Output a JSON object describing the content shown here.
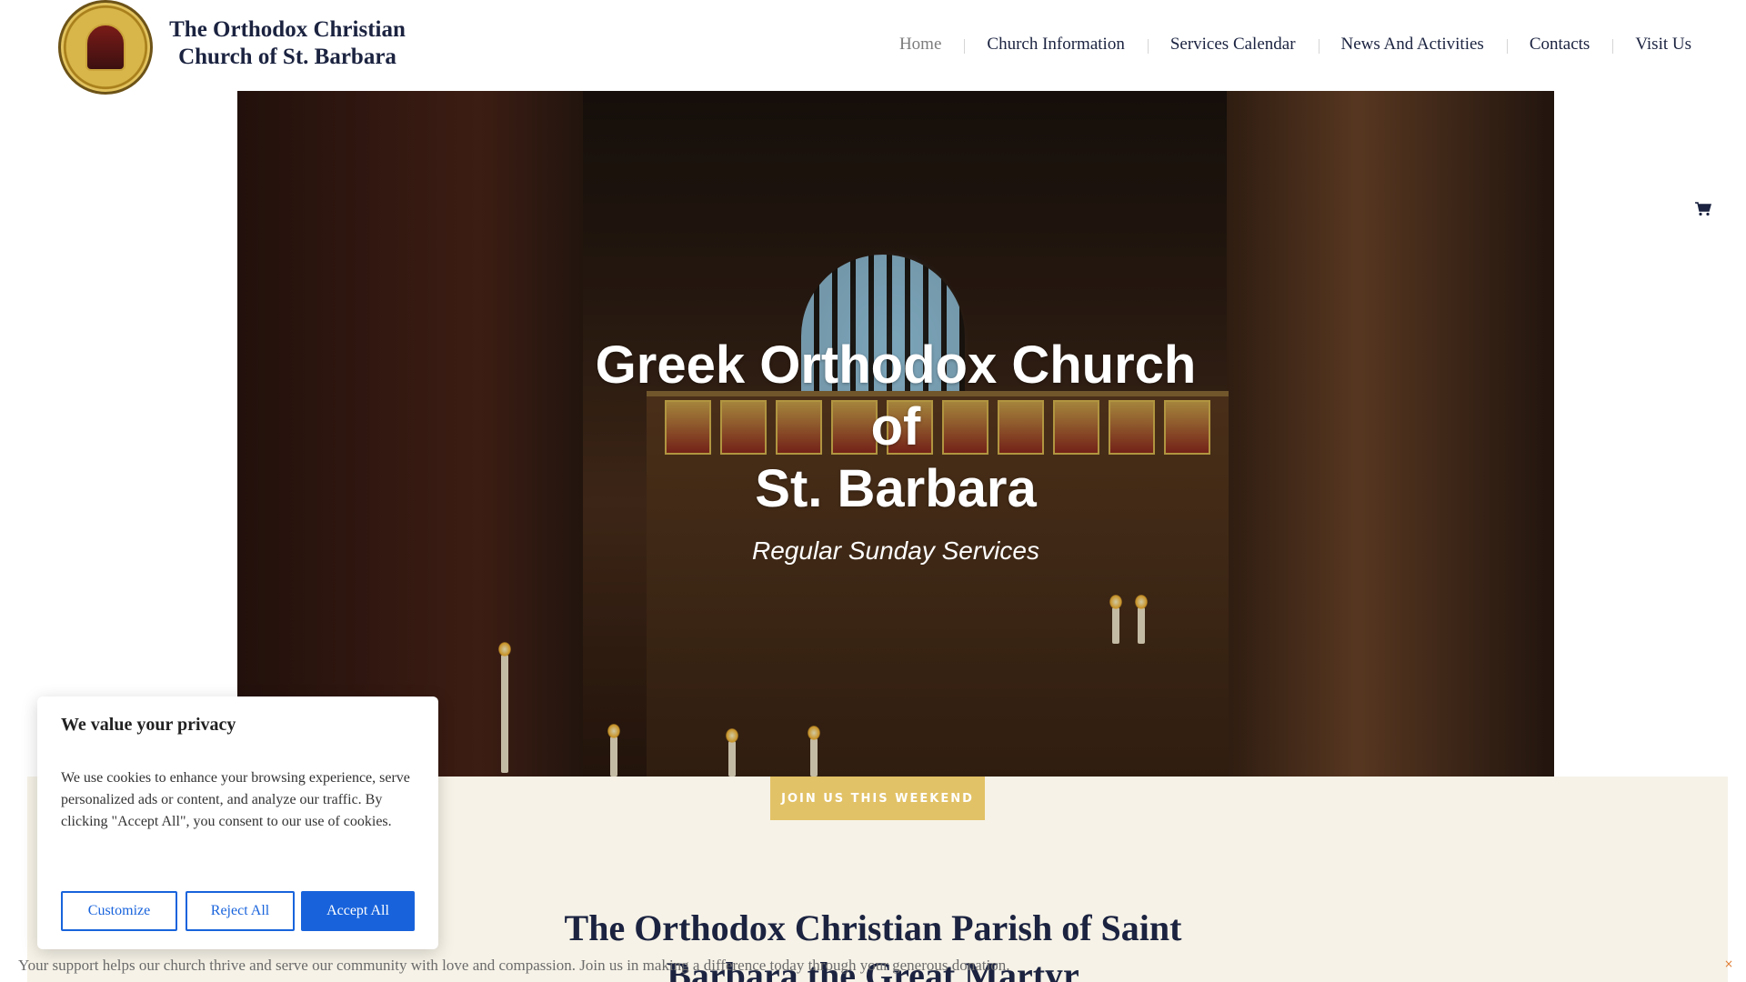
{
  "header": {
    "site_title": "The Orthodox Christian Church of St. Barbara",
    "logo_icon": "church-seal-icon",
    "nav": [
      {
        "label": "Home",
        "active": true
      },
      {
        "label": "Church Information"
      },
      {
        "label": "Services Calendar"
      },
      {
        "label": "News And Activities"
      },
      {
        "label": "Contacts"
      },
      {
        "label": "Visit Us"
      }
    ]
  },
  "hero": {
    "title_line1": "Greek Orthodox Church",
    "title_line2": "of",
    "title_line3": "St. Barbara",
    "subtitle": "Regular Sunday Services"
  },
  "cta": {
    "label": "JOIN US THIS WEEKEND",
    "color": "#e2c266"
  },
  "section": {
    "title": "The Orthodox Christian Parish of Saint Barbara the Great Martyr",
    "background": "#f6f2e7"
  },
  "cart": {
    "icon": "cart-icon"
  },
  "cookie": {
    "heading": "We value your privacy",
    "body": "We use cookies to enhance your browsing experience, serve personalized ads or content, and analyze our traffic. By clicking \"Accept All\", you consent to our use of cookies.",
    "customize": "Customize",
    "reject": "Reject All",
    "accept": "Accept All",
    "accent": "#1863dc"
  },
  "donation": {
    "text": "Your support helps our church thrive and serve our community with love and compassion. Join us in making a difference today through your generous donation.",
    "close": "×"
  }
}
